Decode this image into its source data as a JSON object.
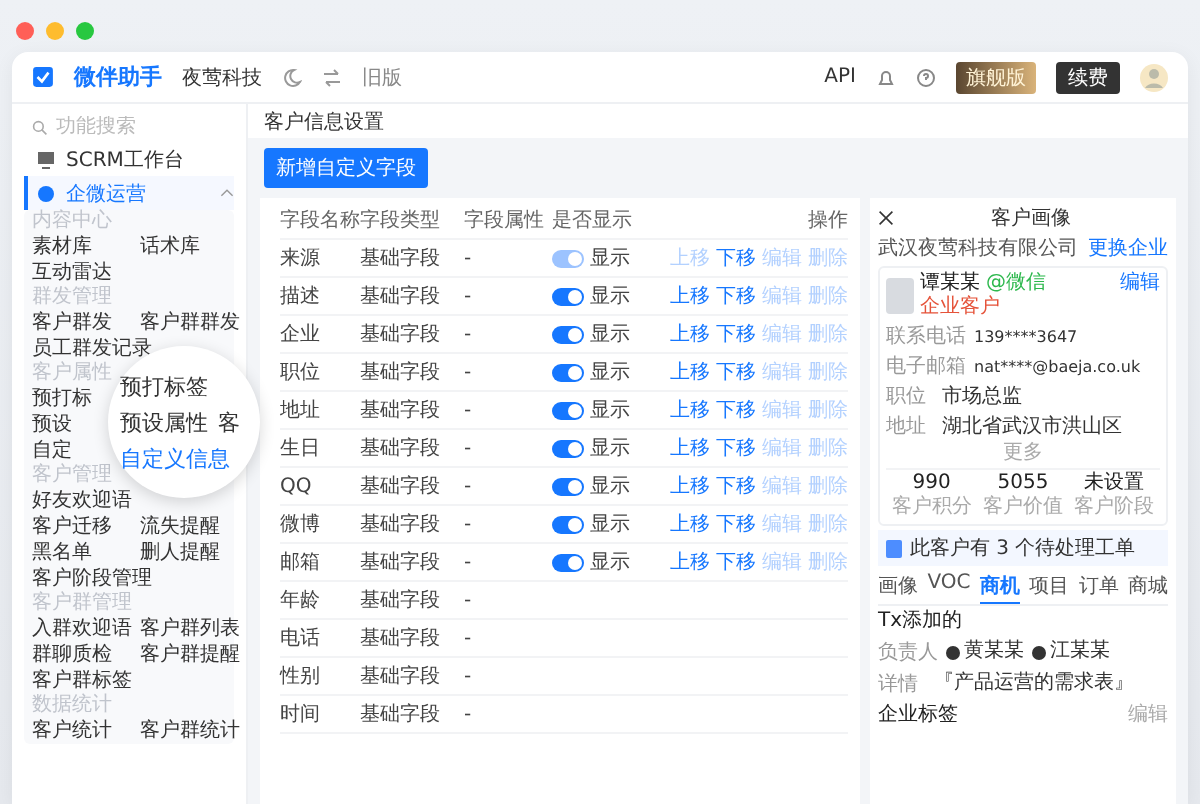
{
  "topbar": {
    "app_name": "微伴助手",
    "company": "夜莺科技",
    "old_version": "旧版",
    "api": "API",
    "plan_badge": "旗舰版",
    "renew": "续费"
  },
  "sidebar": {
    "search_placeholder": "功能搜索",
    "items": [
      {
        "label": "SCRM工作台",
        "selected": false,
        "expanded": false
      },
      {
        "label": "企微运营",
        "selected": true,
        "expanded": true
      }
    ],
    "groups": [
      {
        "title": "内容中心",
        "rows": [
          [
            "素材库",
            "话术库"
          ],
          [
            "互动雷达"
          ]
        ]
      },
      {
        "title": "群发管理",
        "rows": [
          [
            "客户群发",
            "客户群群发"
          ],
          [
            "员工群发记录"
          ]
        ]
      },
      {
        "title": "客户属性",
        "rows": [
          [
            "预打标"
          ],
          [
            "预设"
          ],
          [
            "自定"
          ]
        ],
        "magnifier": {
          "lines": [
            {
              "text": "预打标签",
              "selected": false
            },
            {
              "text": "预设属性",
              "selected": false
            },
            {
              "text": "自定义信息",
              "selected": true
            }
          ],
          "side_text": "客"
        }
      },
      {
        "title": "客户管理",
        "rows": [
          [
            "好友欢迎语"
          ],
          [
            "客户迁移",
            "流失提醒"
          ],
          [
            "黑名单",
            "删人提醒"
          ],
          [
            "客户阶段管理"
          ]
        ]
      },
      {
        "title": "客户群管理",
        "rows": [
          [
            "入群欢迎语",
            "客户群列表"
          ],
          [
            "群聊质检",
            "客户群提醒"
          ],
          [
            "客户群标签"
          ]
        ]
      },
      {
        "title": "数据统计",
        "rows": [
          [
            "客户统计",
            "客户群统计"
          ]
        ]
      }
    ]
  },
  "page": {
    "title": "客户信息设置",
    "add_button": "新增自定义字段"
  },
  "table": {
    "columns": [
      "字段名称",
      "字段类型",
      "字段属性",
      "是否显示",
      "操作"
    ],
    "rows": [
      {
        "name": "来源",
        "type": "基础字段",
        "attr": "-",
        "show": {
          "on": true,
          "disabled": true,
          "label": "显示"
        },
        "ops": [
          {
            "label": "上移",
            "disabled": true
          },
          {
            "label": "下移",
            "disabled": false
          },
          {
            "label": "编辑",
            "disabled": true
          },
          {
            "label": "删除",
            "disabled": true
          }
        ]
      },
      {
        "name": "描述",
        "type": "基础字段",
        "attr": "-",
        "show": {
          "on": true,
          "disabled": false,
          "label": "显示"
        },
        "ops": [
          {
            "label": "上移",
            "disabled": false
          },
          {
            "label": "下移",
            "disabled": false
          },
          {
            "label": "编辑",
            "disabled": true
          },
          {
            "label": "删除",
            "disabled": true
          }
        ]
      },
      {
        "name": "企业",
        "type": "基础字段",
        "attr": "-",
        "show": {
          "on": true,
          "disabled": false,
          "label": "显示"
        },
        "ops": [
          {
            "label": "上移",
            "disabled": false
          },
          {
            "label": "下移",
            "disabled": false
          },
          {
            "label": "编辑",
            "disabled": true
          },
          {
            "label": "删除",
            "disabled": true
          }
        ]
      },
      {
        "name": "职位",
        "type": "基础字段",
        "attr": "-",
        "show": {
          "on": true,
          "disabled": false,
          "label": "显示"
        },
        "ops": [
          {
            "label": "上移",
            "disabled": false
          },
          {
            "label": "下移",
            "disabled": false
          },
          {
            "label": "编辑",
            "disabled": true
          },
          {
            "label": "删除",
            "disabled": true
          }
        ]
      },
      {
        "name": "地址",
        "type": "基础字段",
        "attr": "-",
        "show": {
          "on": true,
          "disabled": false,
          "label": "显示"
        },
        "ops": [
          {
            "label": "上移",
            "disabled": false
          },
          {
            "label": "下移",
            "disabled": false
          },
          {
            "label": "编辑",
            "disabled": true
          },
          {
            "label": "删除",
            "disabled": true
          }
        ]
      },
      {
        "name": "生日",
        "type": "基础字段",
        "attr": "-",
        "show": {
          "on": true,
          "disabled": false,
          "label": "显示"
        },
        "ops": [
          {
            "label": "上移",
            "disabled": false
          },
          {
            "label": "下移",
            "disabled": false
          },
          {
            "label": "编辑",
            "disabled": true
          },
          {
            "label": "删除",
            "disabled": true
          }
        ]
      },
      {
        "name": "QQ",
        "type": "基础字段",
        "attr": "-",
        "show": {
          "on": true,
          "disabled": false,
          "label": "显示"
        },
        "ops": [
          {
            "label": "上移",
            "disabled": false
          },
          {
            "label": "下移",
            "disabled": false
          },
          {
            "label": "编辑",
            "disabled": true
          },
          {
            "label": "删除",
            "disabled": true
          }
        ]
      },
      {
        "name": "微博",
        "type": "基础字段",
        "attr": "-",
        "show": {
          "on": true,
          "disabled": false,
          "label": "显示"
        },
        "ops": [
          {
            "label": "上移",
            "disabled": false
          },
          {
            "label": "下移",
            "disabled": false
          },
          {
            "label": "编辑",
            "disabled": true
          },
          {
            "label": "删除",
            "disabled": true
          }
        ]
      },
      {
        "name": "邮箱",
        "type": "基础字段",
        "attr": "-",
        "show": {
          "on": true,
          "disabled": false,
          "label": "显示"
        },
        "ops": [
          {
            "label": "上移",
            "disabled": false
          },
          {
            "label": "下移",
            "disabled": false
          },
          {
            "label": "编辑",
            "disabled": true
          },
          {
            "label": "删除",
            "disabled": true
          }
        ]
      },
      {
        "name": "年龄",
        "type": "基础字段",
        "attr": "-"
      },
      {
        "name": "电话",
        "type": "基础字段",
        "attr": "-"
      },
      {
        "name": "性别",
        "type": "基础字段",
        "attr": "-"
      },
      {
        "name": "时间",
        "type": "基础字段",
        "attr": "-"
      }
    ]
  },
  "profile": {
    "title": "客户画像",
    "company": "武汉夜莺科技有限公司",
    "change_company": "更换企业",
    "edit": "编辑",
    "name": "谭某某",
    "wechat": "@微信",
    "tag": "企业客户",
    "fields": [
      {
        "label": "联系电话",
        "value": "139****3647"
      },
      {
        "label": "电子邮箱",
        "value": "nat****@baeja.co.uk"
      },
      {
        "label": "职位",
        "value": "市场总监"
      },
      {
        "label": "地址",
        "value": "湖北省武汉市洪山区"
      }
    ],
    "more": "更多",
    "stats": [
      {
        "value": "990",
        "label": "客户积分"
      },
      {
        "value": "5055",
        "label": "客户价值"
      },
      {
        "value": "未设置",
        "label": "客户阶段"
      }
    ],
    "ticket": "此客户有 3 个待处理工单",
    "tabs": [
      {
        "label": "画像",
        "selected": false
      },
      {
        "label": "VOC",
        "selected": false
      },
      {
        "label": "商机",
        "selected": true
      },
      {
        "label": "项目",
        "selected": false
      },
      {
        "label": "订单",
        "selected": false
      },
      {
        "label": "商城",
        "selected": false
      }
    ],
    "added_by": "Tx添加的",
    "owner_label": "负责人",
    "owners": [
      "黄某某",
      "江某某"
    ],
    "detail_label": "详情",
    "detail_value": "『产品运营的需求表』",
    "tags_label": "企业标签",
    "tags_edit": "编辑"
  }
}
